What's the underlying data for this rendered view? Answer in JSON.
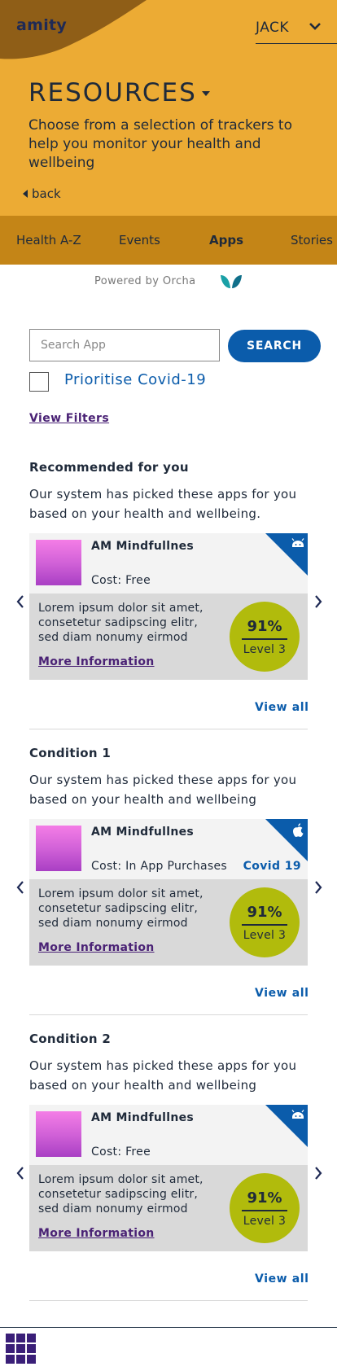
{
  "header": {
    "logo": "amity",
    "user_name": "JACK",
    "title": "RESOURCES",
    "subtitle": "Choose from a selection of trackers to help you monitor your health and wellbeing",
    "back_label": "back",
    "bg_color": "#ecab34"
  },
  "tabs": [
    {
      "label": "Health A-Z",
      "active": false
    },
    {
      "label": "Events",
      "active": false
    },
    {
      "label": "Apps",
      "active": true
    },
    {
      "label": "Stories",
      "active": false
    }
  ],
  "powered_by": "Powered by Orcha",
  "search": {
    "placeholder": "Search App",
    "value": "",
    "button_label": "SEARCH"
  },
  "prioritise": {
    "label": "Prioritise Covid-19",
    "checked": false
  },
  "view_filters": "View Filters",
  "sections": [
    {
      "title": "Recommended for you",
      "description": "Our system has picked these apps for you based on your health and wellbeing.",
      "app": {
        "name": "AM Mindfullnes",
        "cost": "Cost: Free",
        "tag": "",
        "platform_icon": "android-icon",
        "description": "Lorem ipsum dolor sit amet, consetetur sadipscing elitr, sed diam nonumy eirmod",
        "more_info": "More Information",
        "score": "91%",
        "level": "Level 3"
      },
      "view_all": "View all"
    },
    {
      "title": "Condition 1",
      "description": "Our system has picked these apps for you based on your health and wellbeing",
      "app": {
        "name": "AM Mindfullnes",
        "cost": "Cost: In App Purchases",
        "tag": "Covid 19",
        "platform_icon": "apple-icon",
        "description": "Lorem ipsum dolor sit amet, consetetur sadipscing elitr, sed diam nonumy eirmod",
        "more_info": "More Information",
        "score": "91%",
        "level": "Level 3"
      },
      "view_all": "View all"
    },
    {
      "title": "Condition 2",
      "description": "Our system has picked these apps for you based on your health and wellbeing",
      "app": {
        "name": "AM Mindfullnes",
        "cost": "Cost: Free",
        "tag": "",
        "platform_icon": "android-icon",
        "description": "Lorem ipsum dolor sit amet, consetetur sadipscing elitr, sed diam nonumy eirmod",
        "more_info": "More Information",
        "score": "91%",
        "level": "Level 3"
      },
      "view_all": "View all"
    }
  ],
  "colors": {
    "accent_blue": "#0b5cab",
    "link_purple": "#4a2275",
    "score_green": "#b1bb0c",
    "tab_bar": "#c48517"
  }
}
